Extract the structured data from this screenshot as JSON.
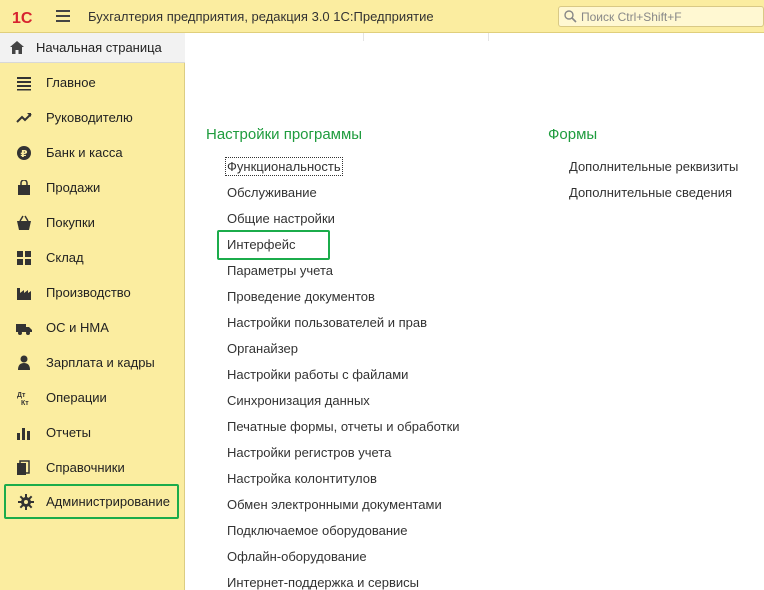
{
  "app": {
    "logo_text": "1С",
    "title": "Бухгалтерия предприятия, редакция 3.0 1С:Предприятие",
    "search_placeholder": "Поиск Ctrl+Shift+F"
  },
  "home": {
    "label": "Начальная страница",
    "icon": "home-icon"
  },
  "sidebar": {
    "items": [
      {
        "label": "Главное",
        "icon": "menu-lines-icon"
      },
      {
        "label": "Руководителю",
        "icon": "trend-up-icon"
      },
      {
        "label": "Банк и касса",
        "icon": "ruble-coin-icon"
      },
      {
        "label": "Продажи",
        "icon": "shopping-bag-icon"
      },
      {
        "label": "Покупки",
        "icon": "basket-icon"
      },
      {
        "label": "Склад",
        "icon": "warehouse-grid-icon"
      },
      {
        "label": "Производство",
        "icon": "factory-icon"
      },
      {
        "label": "ОС и НМА",
        "icon": "truck-icon"
      },
      {
        "label": "Зарплата и кадры",
        "icon": "person-icon"
      },
      {
        "label": "Операции",
        "icon": "debit-credit-icon"
      },
      {
        "label": "Отчеты",
        "icon": "bar-chart-icon"
      },
      {
        "label": "Справочники",
        "icon": "books-icon"
      },
      {
        "label": "Администрирование",
        "icon": "gear-icon"
      }
    ],
    "icon_glyph_dtkt": "Дт\nКт"
  },
  "main": {
    "settings": {
      "title": "Настройки программы",
      "links": [
        "Функциональность",
        "Обслуживание",
        "Общие настройки",
        "Интерфейс",
        "Параметры учета",
        "Проведение документов",
        "Настройки пользователей и прав",
        "Органайзер",
        "Настройки работы с файлами",
        "Синхронизация данных",
        "Печатные формы, отчеты и обработки",
        "Настройки регистров учета",
        "Настройка колонтитулов",
        "Обмен электронными документами",
        "Подключаемое оборудование",
        "Офлайн-оборудование",
        "Интернет-поддержка и сервисы"
      ]
    },
    "forms": {
      "title": "Формы",
      "links": [
        "Дополнительные реквизиты",
        "Дополнительные сведения"
      ]
    }
  },
  "colors": {
    "topbar_bg": "#fbeda0",
    "sidebar_bg": "#fbeda0",
    "section_title": "#1f9c3e",
    "highlight": "#1bac4b",
    "logo_red": "#d7232f"
  }
}
